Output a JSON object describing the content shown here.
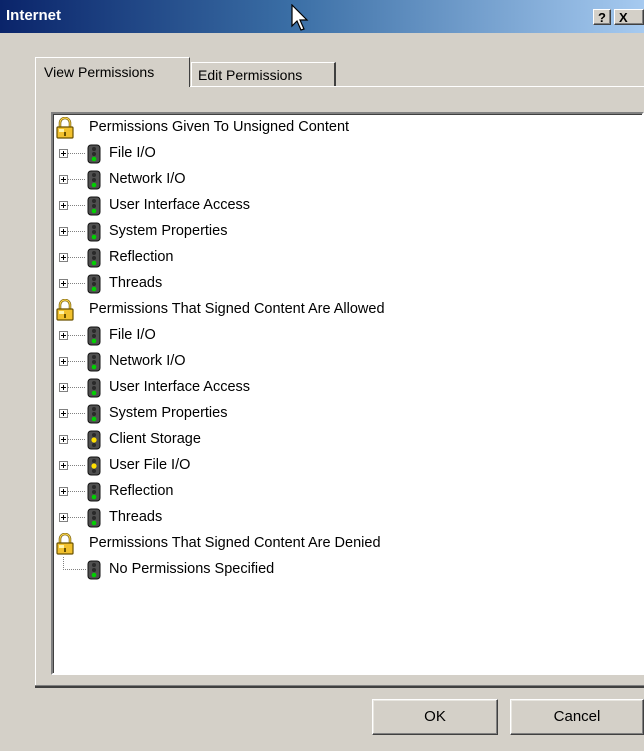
{
  "window": {
    "title": "Internet"
  },
  "titlebar": {
    "help_label": "?",
    "close_label": "X"
  },
  "tabs": [
    {
      "label": "View Permissions",
      "active": true
    },
    {
      "label": "Edit Permissions",
      "active": false
    }
  ],
  "tree": {
    "unsigned": {
      "label": "Permissions Given To Unsigned Content",
      "items": [
        "File I/O",
        "Network I/O",
        "User Interface Access",
        "System Properties",
        "Reflection",
        "Threads"
      ]
    },
    "signed_allowed": {
      "label": "Permissions That Signed Content Are Allowed",
      "items": [
        "File I/O",
        "Network I/O",
        "User Interface Access",
        "System Properties",
        "Client Storage",
        "User File I/O",
        "Reflection",
        "Threads"
      ]
    },
    "signed_denied": {
      "label": "Permissions That Signed Content Are Denied",
      "items": [
        "No Permissions Specified"
      ]
    }
  },
  "buttons": {
    "ok": "OK",
    "cancel": "Cancel"
  },
  "colors": {
    "green_status": "#00cc00",
    "yellow_status": "#ffe000",
    "title_active": "#0a246a",
    "face": "#d4d0c8"
  },
  "icons": {
    "category": "padlock-icon",
    "permission_green": "traffic-light-green-icon",
    "permission_yellow": "traffic-light-yellow-icon"
  }
}
